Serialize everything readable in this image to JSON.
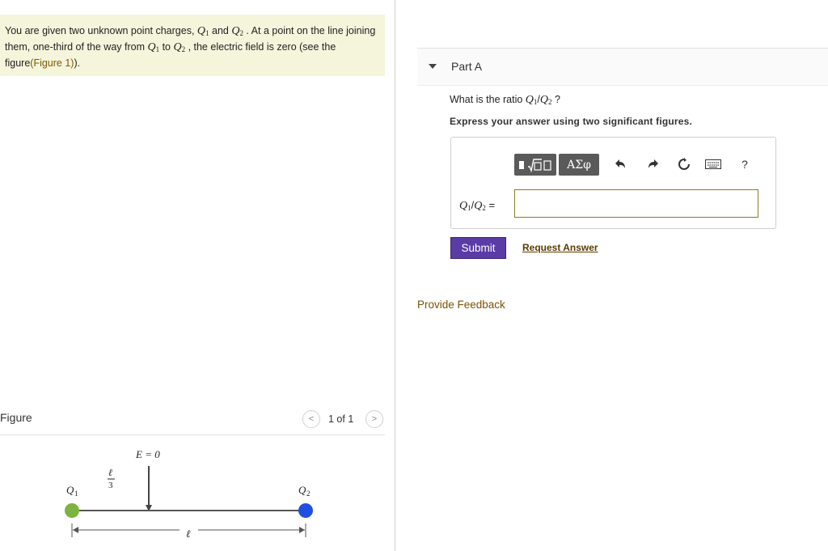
{
  "problem": {
    "part1": "You are given two unknown point charges, ",
    "q_letter": "Q",
    "q1_sub": "1",
    "q2_sub": "2",
    "and": " and ",
    "part2": " . At a point on the line joining them, one-third of the way from ",
    "to": " to ",
    "part3": " , the electric field is zero (see the figure",
    "figure_link": "(Figure 1)",
    "part4": ")."
  },
  "part_a": {
    "label": "Part A",
    "question_prefix": "What is the ratio ",
    "question_suffix": " ?",
    "instruction": "Express your answer using two significant figures.",
    "toolbar": {
      "symbols_label": "ΑΣφ",
      "help_label": "?"
    },
    "answer_label_ratio": "/",
    "answer_label_eq": " =",
    "answer_value": "",
    "submit_label": "Submit",
    "request_label": "Request Answer"
  },
  "feedback_label": "Provide Feedback",
  "figure": {
    "title": "Figure",
    "pager": "1 of 1",
    "prev_label": "<",
    "next_label": ">",
    "e_label": "E = 0",
    "frac_num": "ℓ",
    "frac_den": "3",
    "q1_label": "Q",
    "q1_sub": "1",
    "q2_label": "Q",
    "q2_sub": "2",
    "length_label": "ℓ",
    "q1_color": "#7cb342",
    "q2_color": "#1f4fe0"
  }
}
